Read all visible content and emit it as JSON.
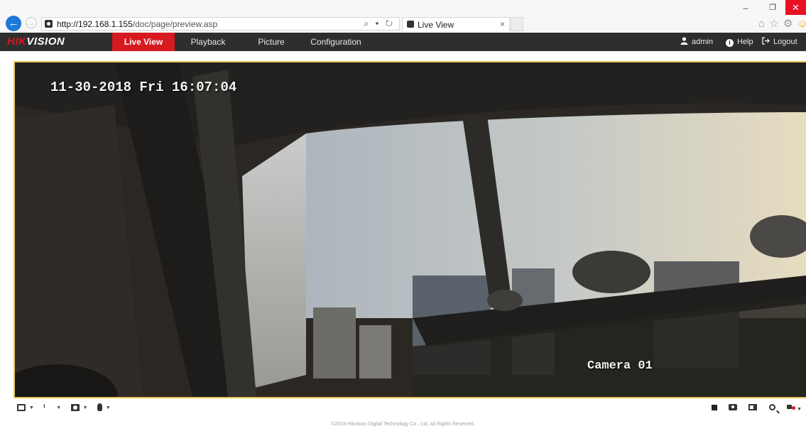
{
  "browser": {
    "url_host": "http://192.168.1.155",
    "url_path": "/doc/page/preview.asp",
    "url_tools": "⌕ ▾ ↻",
    "tab_title": "Live View",
    "tab_close": "×",
    "back_glyph": "←",
    "forward_glyph": "→",
    "win_min": "–",
    "win_max": "❐",
    "win_close": "✕",
    "tool_icons": "⌂ ☆ ⚙",
    "smile_icon": "☺"
  },
  "header": {
    "logo_red": "HIK",
    "logo_white": "VISION",
    "nav": [
      {
        "label": "Live View",
        "active": true
      },
      {
        "label": "Playback"
      },
      {
        "label": "Picture"
      },
      {
        "label": "Configuration"
      }
    ],
    "user": "admin",
    "help": "Help",
    "logout": "Logout",
    "user_icon": "user-icon",
    "logout_icon": "logout-icon"
  },
  "video": {
    "timestamp": "11-30-2018 Fri 16:07:04",
    "camera_name": "Camera 01",
    "frame_color": "#e6c55a"
  },
  "toolbar": {
    "left_icons": [
      "window-layout-icon",
      "stream-type-icon",
      "plugin-icon",
      "microphone-icon"
    ],
    "right_icons": [
      "stop-all-icon",
      "capture-icon",
      "record-clip-icon",
      "digital-zoom-icon",
      "volume-icon"
    ],
    "caret": "▼"
  },
  "footer": {
    "copyright": "©2018 Hikvision Digital Technology Co., Ltd. All Rights Reserved."
  },
  "colors": {
    "brand_red": "#d71920",
    "header_bg": "#2e2e2e",
    "browser_back": "#1e78d7",
    "win_close": "#e81123"
  }
}
